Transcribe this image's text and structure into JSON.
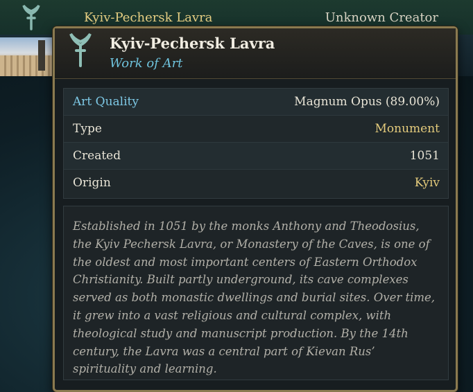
{
  "background": {
    "title": "Kyiv-Pechersk Lavra",
    "creator": "Unknown Creator",
    "icon": "trident-emblem-icon"
  },
  "tooltip": {
    "icon": "trident-emblem-icon",
    "title": "Kyiv-Pechersk Lavra",
    "subtitle": "Work of Art",
    "stats": [
      {
        "label": "Art Quality",
        "value": "Magnum Opus (89.00%)"
      },
      {
        "label": "Type",
        "value": "Monument"
      },
      {
        "label": "Created",
        "value": "1051"
      },
      {
        "label": "Origin",
        "value": "Kyiv"
      }
    ],
    "description": "Established in 1051 by the monks Anthony and Theodosius, the Kyiv Pechersk Lavra, or Monastery of the Caves, is one of the oldest and most important centers of Eastern Orthodox Christianity. Built partly underground, its cave complexes served as both monastic dwellings and burial sites. Over time, it grew into a vast religious and cultural complex, with theological study and manuscript production. By the 14th century, the Lavra was a central part of Kievan Rus’ spirituality and learning."
  },
  "colors": {
    "gold": "#e4cb7c",
    "accent_blue": "#7ec9e6",
    "frame": "#8a7a50"
  }
}
